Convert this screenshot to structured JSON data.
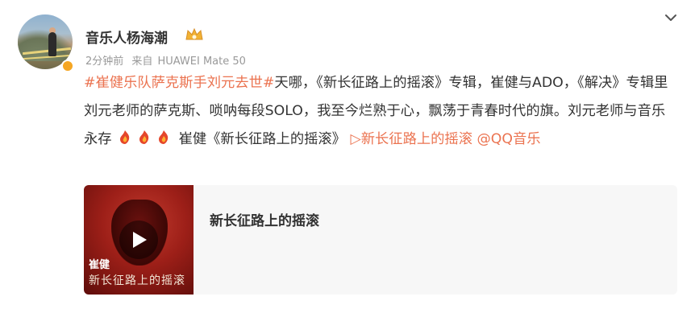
{
  "header": {
    "username": "音乐人杨海潮",
    "vip_badge_icon": "crown-badge-icon",
    "timestamp": "2分钟前",
    "source_prefix": "来自",
    "source_device": "HUAWEI Mate 50",
    "menu_icon": "chevron-down-icon"
  },
  "post": {
    "topic": "#崔健乐队萨克斯手刘元去世#",
    "text1": "天哪，《新长征路上的摇滚》专辑，崔健与ADO，《解决》专辑里刘元老师的萨克斯、唢呐每段SOLO，我至今烂熟于心，飘荡于青春时代的旗。刘元老师与音乐永存",
    "text2": " 崔健《新长征路上的摇滚》",
    "music_link": "▷新长征路上的摇滚",
    "mention": "@QQ音乐",
    "emoji_count": 3,
    "emoji_icon": "candle-emoji-icon"
  },
  "card": {
    "title": "新长征路上的摇滚",
    "cover_artist": "崔健",
    "cover_album": "新长征路上的摇滚",
    "play_icon": "play-icon"
  },
  "colors": {
    "link": "#eb7350",
    "text": "#333333",
    "meta": "#999999",
    "card_bg": "#f7f7f7"
  }
}
